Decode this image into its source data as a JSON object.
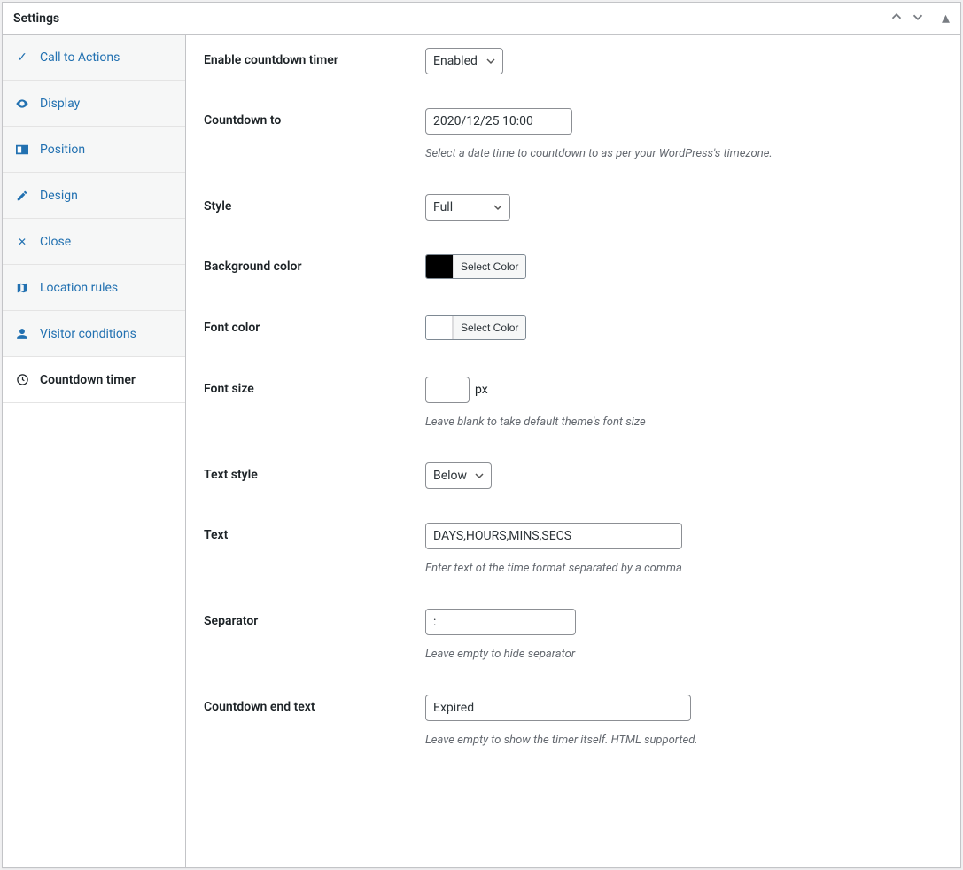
{
  "header": {
    "title": "Settings"
  },
  "tabs": [
    {
      "label": "Call to Actions",
      "icon": "✓"
    },
    {
      "label": "Display",
      "icon": "eye"
    },
    {
      "label": "Position",
      "icon": "layout"
    },
    {
      "label": "Design",
      "icon": "pencil"
    },
    {
      "label": "Close",
      "icon": "✕"
    },
    {
      "label": "Location rules",
      "icon": "map"
    },
    {
      "label": "Visitor conditions",
      "icon": "user"
    },
    {
      "label": "Countdown timer",
      "icon": "clock",
      "active": true
    }
  ],
  "fields": {
    "enable_countdown": {
      "label": "Enable countdown timer",
      "value": "Enabled"
    },
    "countdown_to": {
      "label": "Countdown to",
      "value": "2020/12/25 10:00",
      "help": "Select a date time to countdown to as per your WordPress's timezone."
    },
    "style": {
      "label": "Style",
      "value": "Full"
    },
    "bg_color": {
      "label": "Background color",
      "button": "Select Color",
      "swatch": "#000000"
    },
    "font_color": {
      "label": "Font color",
      "button": "Select Color",
      "swatch": "#ffffff"
    },
    "font_size": {
      "label": "Font size",
      "value": "",
      "unit": "px",
      "help": "Leave blank to take default theme's font size"
    },
    "text_style": {
      "label": "Text style",
      "value": "Below"
    },
    "text": {
      "label": "Text",
      "value": "DAYS,HOURS,MINS,SECS",
      "help": "Enter text of the time format separated by a comma"
    },
    "separator": {
      "label": "Separator",
      "value": ":",
      "help": "Leave empty to hide separator"
    },
    "end_text": {
      "label": "Countdown end text",
      "value": "Expired",
      "help": "Leave empty to show the timer itself. HTML supported."
    }
  }
}
